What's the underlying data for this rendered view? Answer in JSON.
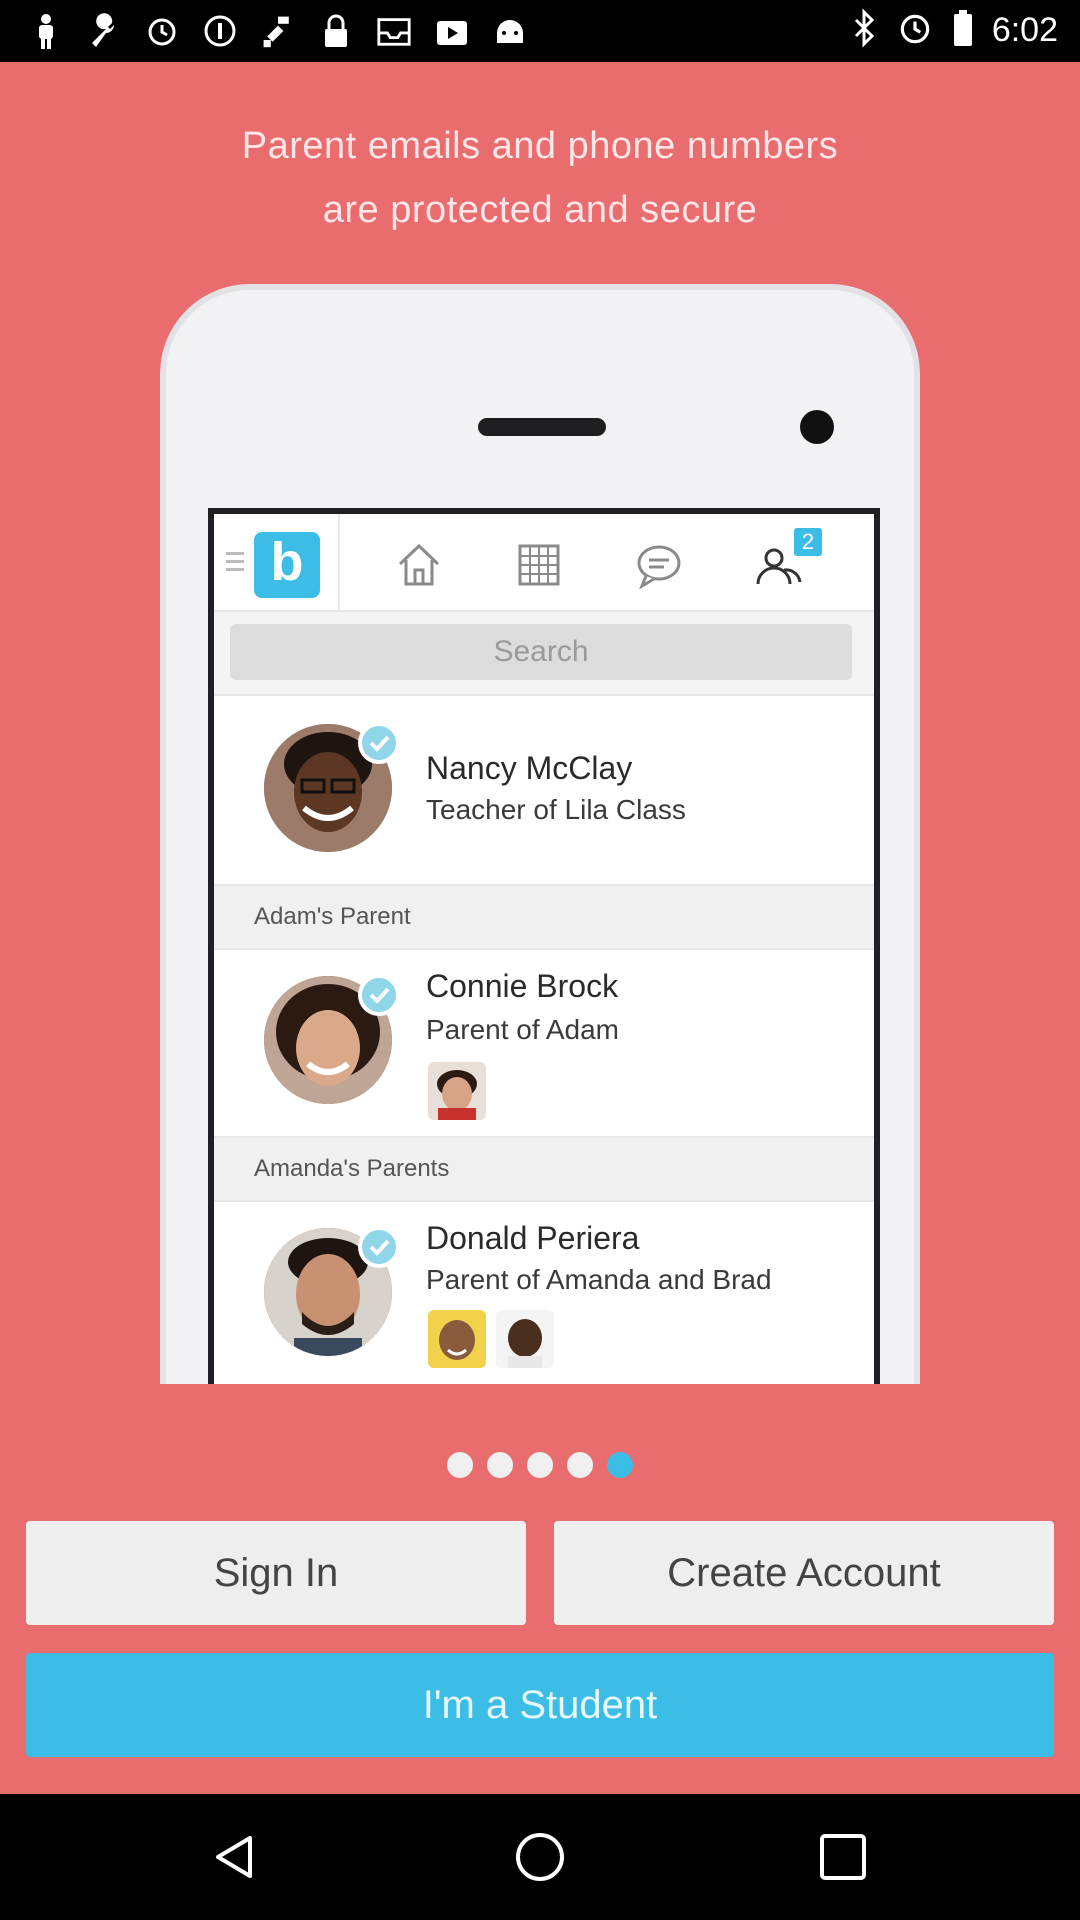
{
  "status_bar": {
    "time": "6:02",
    "left_icons": [
      "person-icon",
      "wrench-icon",
      "alarm-icon",
      "info-icon",
      "fake-gps-icon",
      "lock-icon",
      "inbox-icon",
      "play-store-icon",
      "android-icon"
    ],
    "right_icons": [
      "bluetooth-icon",
      "alarm-icon"
    ]
  },
  "headline": {
    "line1": "Parent emails and phone numbers",
    "line2": "are protected and secure"
  },
  "phone_screen": {
    "logo_letter": "b",
    "notification_badge": "2",
    "search_placeholder": "Search",
    "contacts": [
      {
        "name": "Nancy McClay",
        "subtitle": "Teacher of Lila Class"
      },
      {
        "section": "Adam's Parent",
        "name": "Connie Brock",
        "subtitle": "Parent of Adam"
      },
      {
        "section": "Amanda's Parents",
        "name": "Donald Periera",
        "subtitle": "Parent of Amanda and Brad"
      }
    ]
  },
  "pager": {
    "total": 5,
    "active_index": 4
  },
  "buttons": {
    "sign_in": "Sign In",
    "create_account": "Create Account",
    "student": "I'm a Student"
  },
  "colors": {
    "background": "#E96C6E",
    "accent": "#3CBDE6",
    "button_light": "#EEEEEE"
  },
  "nav_bar": [
    "back-icon",
    "home-icon",
    "recents-icon"
  ]
}
